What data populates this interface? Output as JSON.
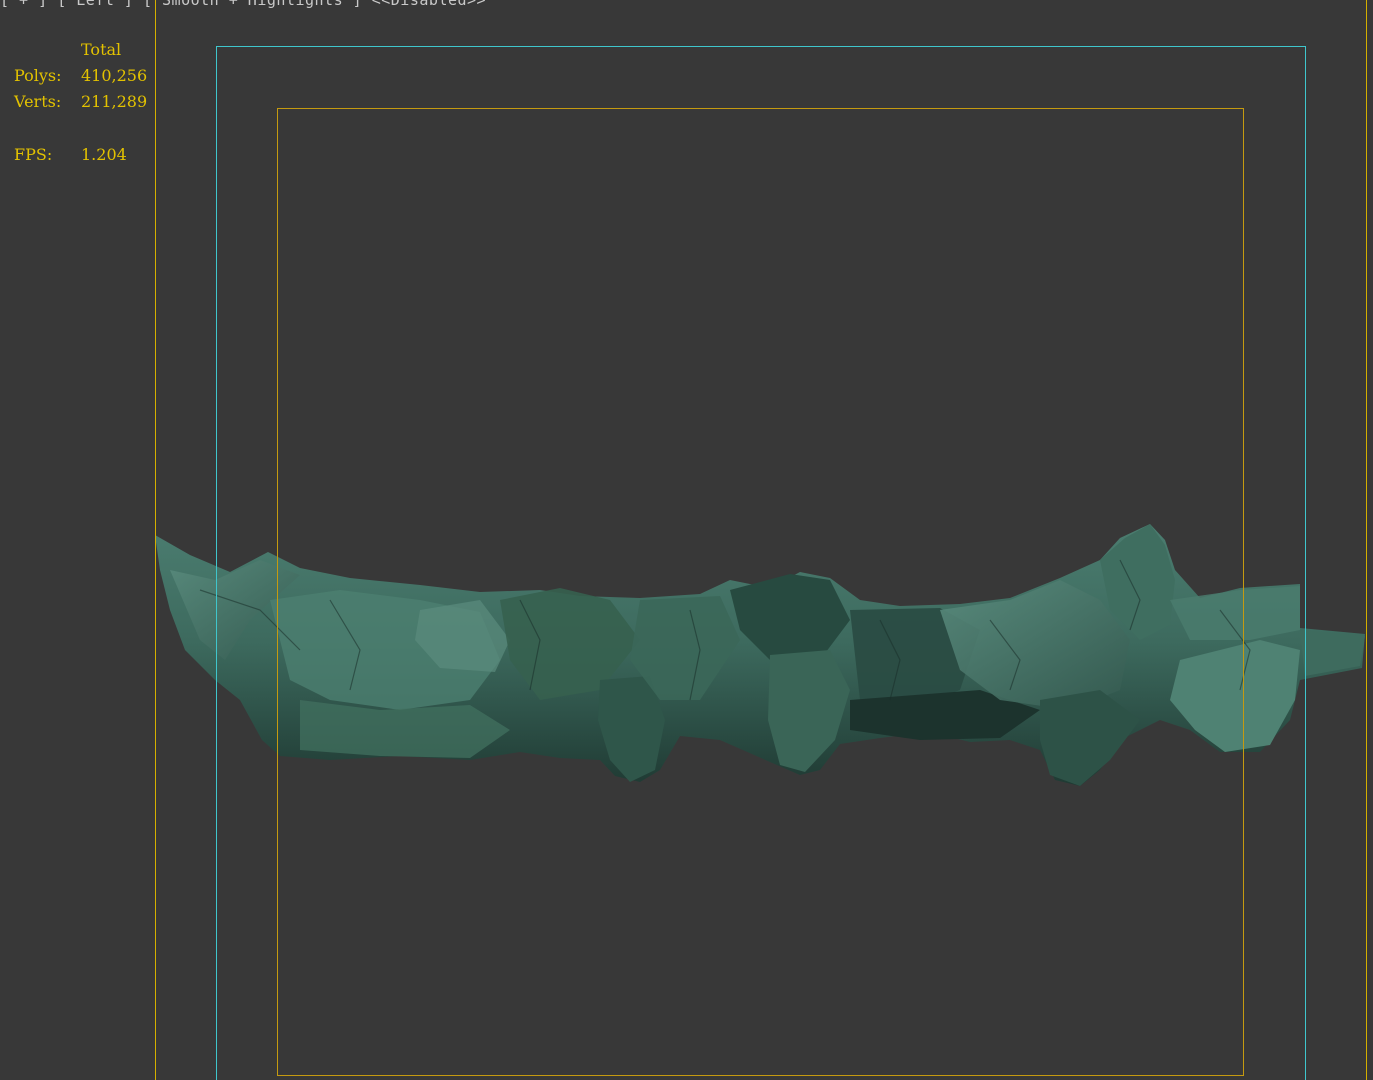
{
  "viewport": {
    "label": {
      "plus": "[ + ]",
      "view": "[ Left ]",
      "shading": "[ Smooth + Highlights ]",
      "state": "<<Disabled>>"
    },
    "stats": {
      "header": "Total",
      "polys_label": "Polys:",
      "polys_value": "410,256",
      "verts_label": "Verts:",
      "verts_value": "211,289",
      "fps_label": "FPS:",
      "fps_value": "1.204"
    },
    "colors": {
      "background": "#383838",
      "stats_text": "#e3c200",
      "safe_frame_outer": "#d4b000",
      "safe_frame_live": "#3fc6cc",
      "safe_frame_action": "#c49a10",
      "mesh": "#3e6b5e"
    }
  }
}
